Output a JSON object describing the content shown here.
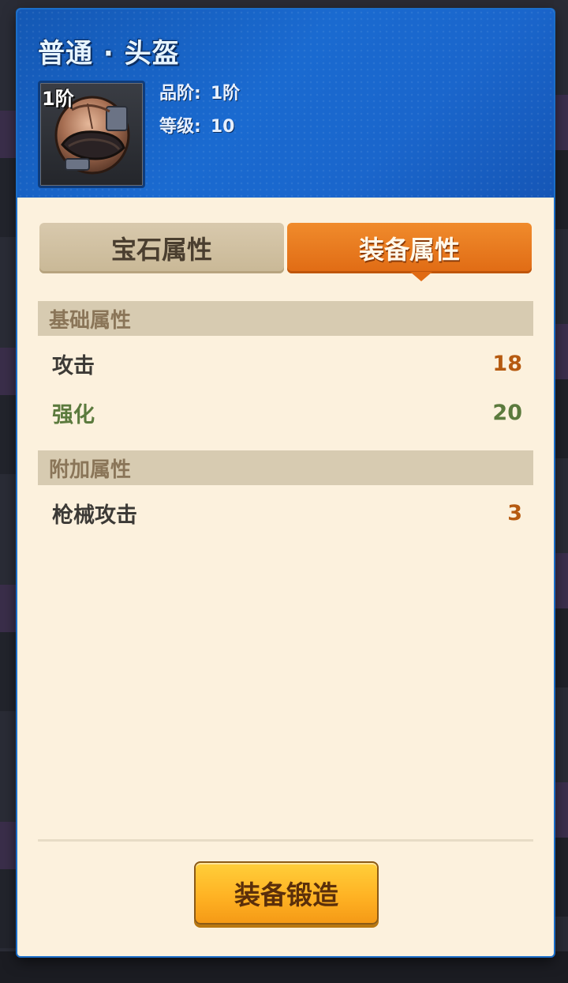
{
  "header": {
    "title": "普通 · 头盔",
    "tier_badge": "1阶",
    "quality_label": "品阶:",
    "quality_value": "1阶",
    "level_label": "等级:",
    "level_value": "10",
    "item_icon": "helmet-icon"
  },
  "tabs": [
    {
      "label": "宝石属性",
      "active": false
    },
    {
      "label": "装备属性",
      "active": true
    }
  ],
  "sections": {
    "basic": {
      "title": "基础属性",
      "rows": [
        {
          "name": "攻击",
          "value": "18"
        },
        {
          "name": "强化",
          "value": "20"
        }
      ]
    },
    "extra": {
      "title": "附加属性",
      "rows": [
        {
          "name": "枪械攻击",
          "value": "3"
        }
      ]
    }
  },
  "footer": {
    "forge_button": "装备锻造"
  },
  "colors": {
    "header_blue": "#1a66cc",
    "active_tab_orange": "#e06b14",
    "value_orange": "#b65a10",
    "enhance_green": "#5b7a3d",
    "panel_bg": "#fcf1dd",
    "button_yellow": "#ffb324"
  }
}
